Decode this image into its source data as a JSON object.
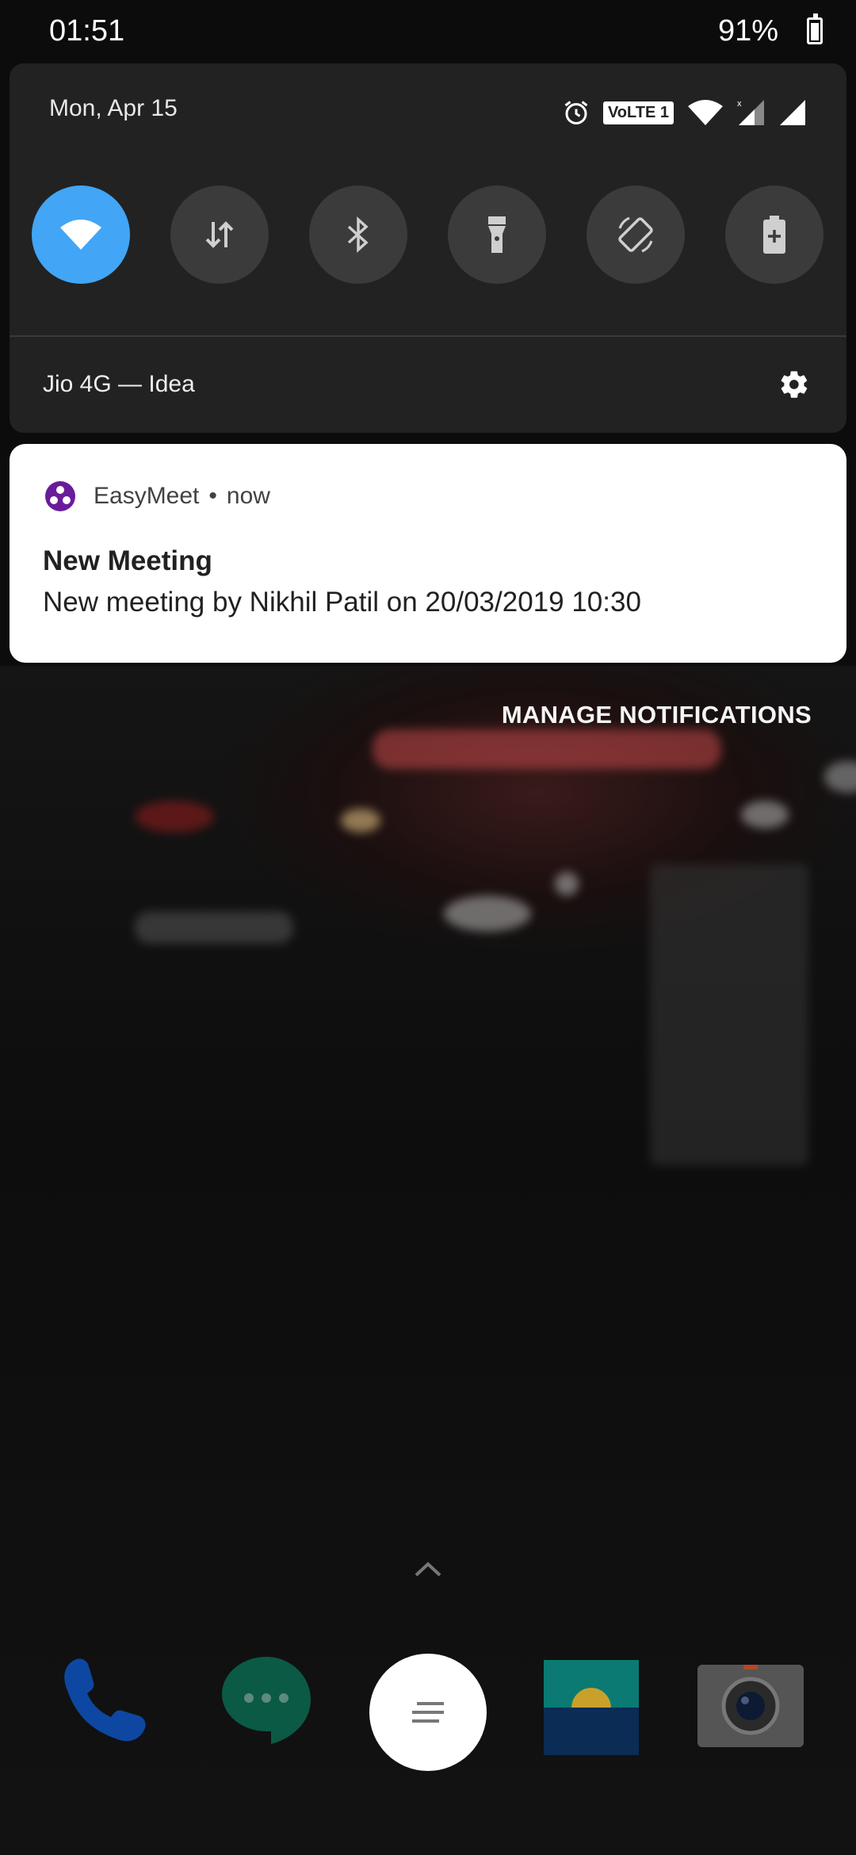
{
  "status_bar": {
    "time": "01:51",
    "battery": "91%"
  },
  "quick_settings": {
    "date": "Mon, Apr 15",
    "volte_label": "VoLTE 1",
    "carrier": "Jio 4G — Idea",
    "tiles": [
      {
        "icon": "wifi-icon",
        "active": true
      },
      {
        "icon": "mobile-data-icon",
        "active": false
      },
      {
        "icon": "bluetooth-icon",
        "active": false
      },
      {
        "icon": "flashlight-icon",
        "active": false
      },
      {
        "icon": "auto-rotate-icon",
        "active": false
      },
      {
        "icon": "battery-saver-icon",
        "active": false
      }
    ],
    "active_color": "#42a5f5"
  },
  "notification": {
    "app_name": "EasyMeet",
    "separator": "•",
    "time": "now",
    "title": "New Meeting",
    "text": "New meeting by Nikhil Patil on 20/03/2019 10:30",
    "app_icon_color": "#6a1b9a"
  },
  "manage_notifications_label": "MANAGE NOTIFICATIONS",
  "dock": {
    "apps": [
      "phone-app-icon",
      "hangouts-app-icon",
      "app-drawer-icon",
      "wallpaper-app-icon",
      "camera-app-icon"
    ]
  }
}
